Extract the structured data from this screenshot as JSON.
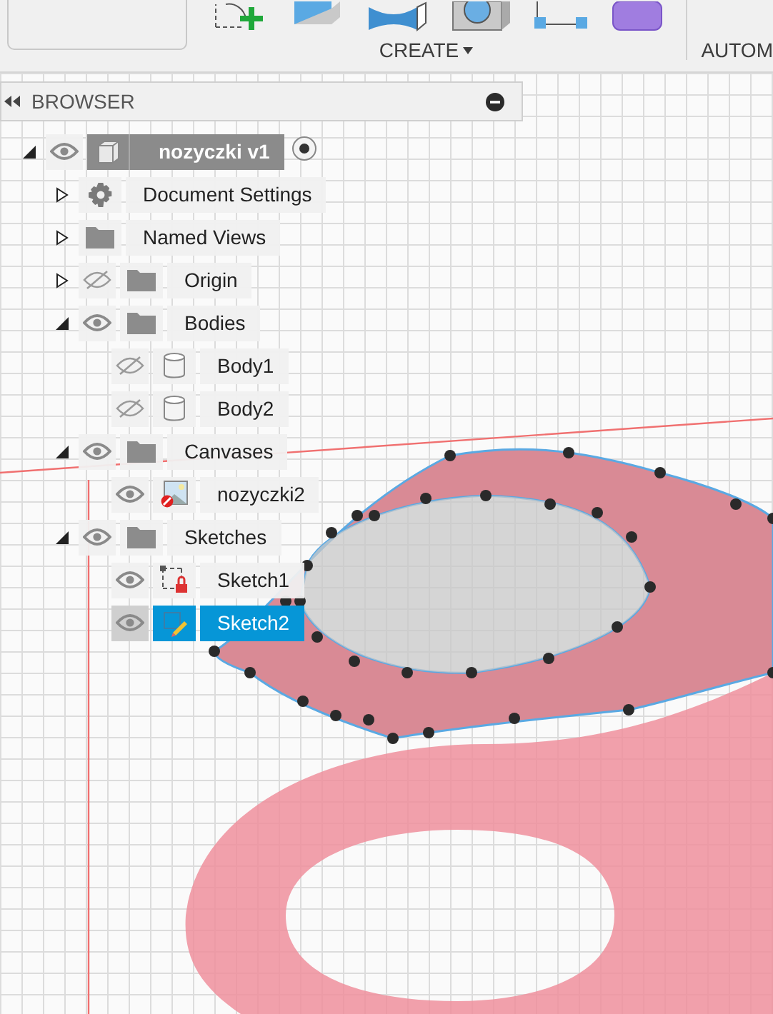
{
  "toolbar": {
    "groups": [
      {
        "label": "CREATE"
      },
      {
        "label": "AUTOM"
      }
    ]
  },
  "browser": {
    "title": "BROWSER",
    "tree": [
      {
        "label": "nozyczki v1",
        "kind": "component",
        "expanded": true,
        "visible": true,
        "selected": false,
        "children": [
          {
            "label": "Document Settings",
            "kind": "settings",
            "expanded": false,
            "selected": false
          },
          {
            "label": "Named Views",
            "kind": "named-views",
            "expanded": false,
            "selected": false
          },
          {
            "label": "Origin",
            "kind": "folder",
            "expanded": false,
            "visible": false,
            "selected": false
          },
          {
            "label": "Bodies",
            "kind": "folder",
            "expanded": true,
            "visible": true,
            "selected": false,
            "children": [
              {
                "label": "Body1",
                "kind": "body",
                "visible": false,
                "selected": false
              },
              {
                "label": "Body2",
                "kind": "body",
                "visible": false,
                "selected": false
              }
            ]
          },
          {
            "label": "Canvases",
            "kind": "folder",
            "expanded": true,
            "visible": true,
            "selected": false,
            "children": [
              {
                "label": "nozyczki2",
                "kind": "canvas",
                "visible": true,
                "selected": false
              }
            ]
          },
          {
            "label": "Sketches",
            "kind": "folder",
            "expanded": true,
            "visible": true,
            "selected": false,
            "children": [
              {
                "label": "Sketch1",
                "kind": "sketch",
                "visible": true,
                "selected": false
              },
              {
                "label": "Sketch2",
                "kind": "sketch",
                "visible": true,
                "selected": true
              }
            ]
          }
        ]
      }
    ]
  }
}
